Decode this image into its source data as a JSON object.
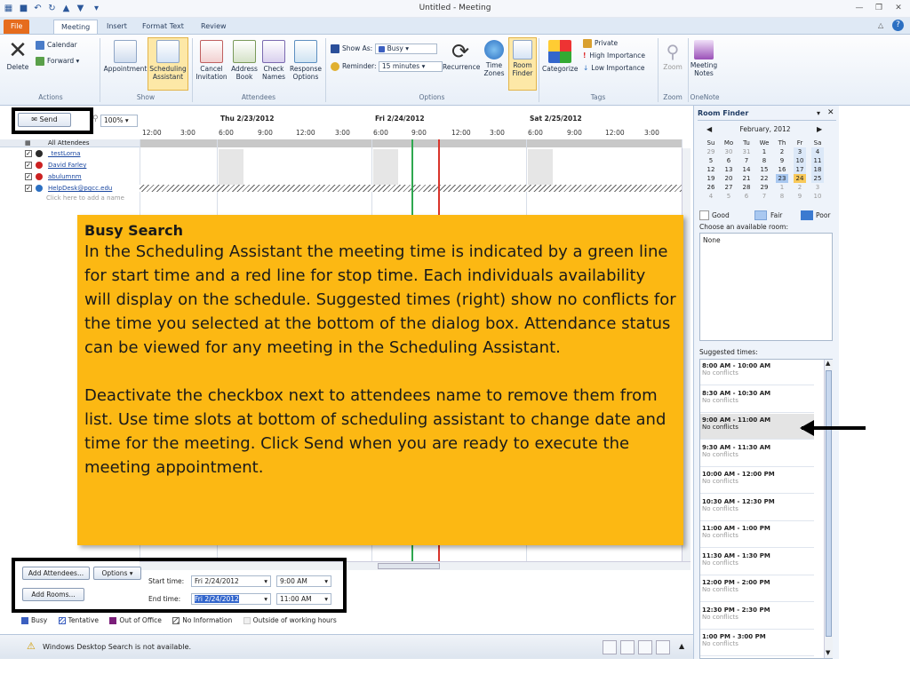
{
  "window": {
    "title": "Untitled - Meeting"
  },
  "tabs": [
    "File",
    "Meeting",
    "Insert",
    "Format Text",
    "Review"
  ],
  "ribbon": {
    "groups": {
      "actions": "Actions",
      "show": "Show",
      "attendees": "Attendees",
      "options": "Options",
      "tags": "Tags",
      "zoom": "Zoom",
      "onenote": "OneNote"
    },
    "delete": "Delete",
    "calendar": "Calendar",
    "forward": "Forward",
    "appointment": "Appointment",
    "scheduling_line1": "Scheduling",
    "scheduling_line2": "Assistant",
    "cancel_line1": "Cancel",
    "cancel_line2": "Invitation",
    "address_line1": "Address",
    "address_line2": "Book",
    "check_line1": "Check",
    "check_line2": "Names",
    "response_line1": "Response",
    "response_line2": "Options",
    "show_as_label": "Show As:",
    "show_as_value": "Busy",
    "reminder_label": "Reminder:",
    "reminder_value": "15 minutes",
    "recurrence": "Recurrence",
    "timezones_line1": "Time",
    "timezones_line2": "Zones",
    "roomfinder_line1": "Room",
    "roomfinder_line2": "Finder",
    "categorize": "Categorize",
    "private": "Private",
    "high_importance": "High Importance",
    "low_importance": "Low Importance",
    "zoom_btn": "Zoom",
    "meeting_notes_line1": "Meeting",
    "meeting_notes_line2": "Notes"
  },
  "scheduler": {
    "send": "Send",
    "zoom": "100%",
    "days": [
      "Thu 2/23/2012",
      "Fri 2/24/2012",
      "Sat 2/25/2012"
    ],
    "times": [
      "12:00",
      "3:00",
      "6:00",
      "9:00",
      "12:00",
      "3:00",
      "6:00",
      "9:00",
      "12:00",
      "3:00",
      "6:00",
      "9:00",
      "12:00",
      "3:00"
    ],
    "all_attendees": "All Attendees",
    "attendees": [
      "_testLorna",
      "David Farley",
      "abulumnm",
      "HelpDesk@pgcc.edu"
    ],
    "add_name": "Click here to add a name"
  },
  "overlay": {
    "title": "Busy Search",
    "p1": "In the Scheduling Assistant the meeting time is indicated by a green line for start time and a red line for stop time. Each individuals availability will display on the schedule. Suggested times (right) show no conflicts for the time you selected at the bottom of the dialog box. Attendance status can be viewed for any meeting in the Scheduling Assistant.",
    "p2": "Deactivate the checkbox next to attendees name to remove them from list. Use time slots at bottom of scheduling assistant to change date and time for the meeting. Click Send when you are ready to execute the meeting appointment."
  },
  "timeframe": {
    "add_attendees": "Add Attendees...",
    "options": "Options",
    "add_rooms": "Add Rooms...",
    "start_label": "Start time:",
    "end_label": "End time:",
    "start_date": "Fri 2/24/2012",
    "start_time": "9:00 AM",
    "end_date": "Fri 2/24/2012",
    "end_time": "11:00 AM"
  },
  "legend": [
    "Busy",
    "Tentative",
    "Out of Office",
    "No Information",
    "Outside of working hours"
  ],
  "status": {
    "message": "Windows Desktop Search is not available."
  },
  "room_finder": {
    "title": "Room Finder",
    "month": "February, 2012",
    "weekdays": [
      "Su",
      "Mo",
      "Tu",
      "We",
      "Th",
      "Fr",
      "Sa"
    ],
    "weeks": [
      [
        "29",
        "30",
        "31",
        "1",
        "2",
        "3",
        "4"
      ],
      [
        "5",
        "6",
        "7",
        "8",
        "9",
        "10",
        "11"
      ],
      [
        "12",
        "13",
        "14",
        "15",
        "16",
        "17",
        "18"
      ],
      [
        "19",
        "20",
        "21",
        "22",
        "23",
        "24",
        "25"
      ],
      [
        "26",
        "27",
        "28",
        "29",
        "1",
        "2",
        "3"
      ],
      [
        "4",
        "5",
        "6",
        "7",
        "8",
        "9",
        "10"
      ]
    ],
    "good": "Good",
    "fair": "Fair",
    "poor": "Poor",
    "choose_room": "Choose an available room:",
    "rooms_value": "None",
    "suggested_label": "Suggested times:",
    "suggestions": [
      {
        "time": "8:00 AM - 10:00 AM",
        "status": "No conflicts"
      },
      {
        "time": "8:30 AM - 10:30 AM",
        "status": "No conflicts"
      },
      {
        "time": "9:00 AM - 11:00 AM",
        "status": "No conflicts"
      },
      {
        "time": "9:30 AM - 11:30 AM",
        "status": "No conflicts"
      },
      {
        "time": "10:00 AM - 12:00 PM",
        "status": "No conflicts"
      },
      {
        "time": "10:30 AM - 12:30 PM",
        "status": "No conflicts"
      },
      {
        "time": "11:00 AM - 1:00 PM",
        "status": "No conflicts"
      },
      {
        "time": "11:30 AM - 1:30 PM",
        "status": "No conflicts"
      },
      {
        "time": "12:00 PM - 2:00 PM",
        "status": "No conflicts"
      },
      {
        "time": "12:30 PM - 2:30 PM",
        "status": "No conflicts"
      },
      {
        "time": "1:00 PM - 3:00 PM",
        "status": "No conflicts"
      }
    ]
  },
  "colors": {
    "overlay": "#fcb813",
    "file_tab": "#e66c1d",
    "start_line": "#2fa84f",
    "end_line": "#d9342b",
    "busy": "#3b5fc0",
    "oof": "#7b1e7a"
  }
}
